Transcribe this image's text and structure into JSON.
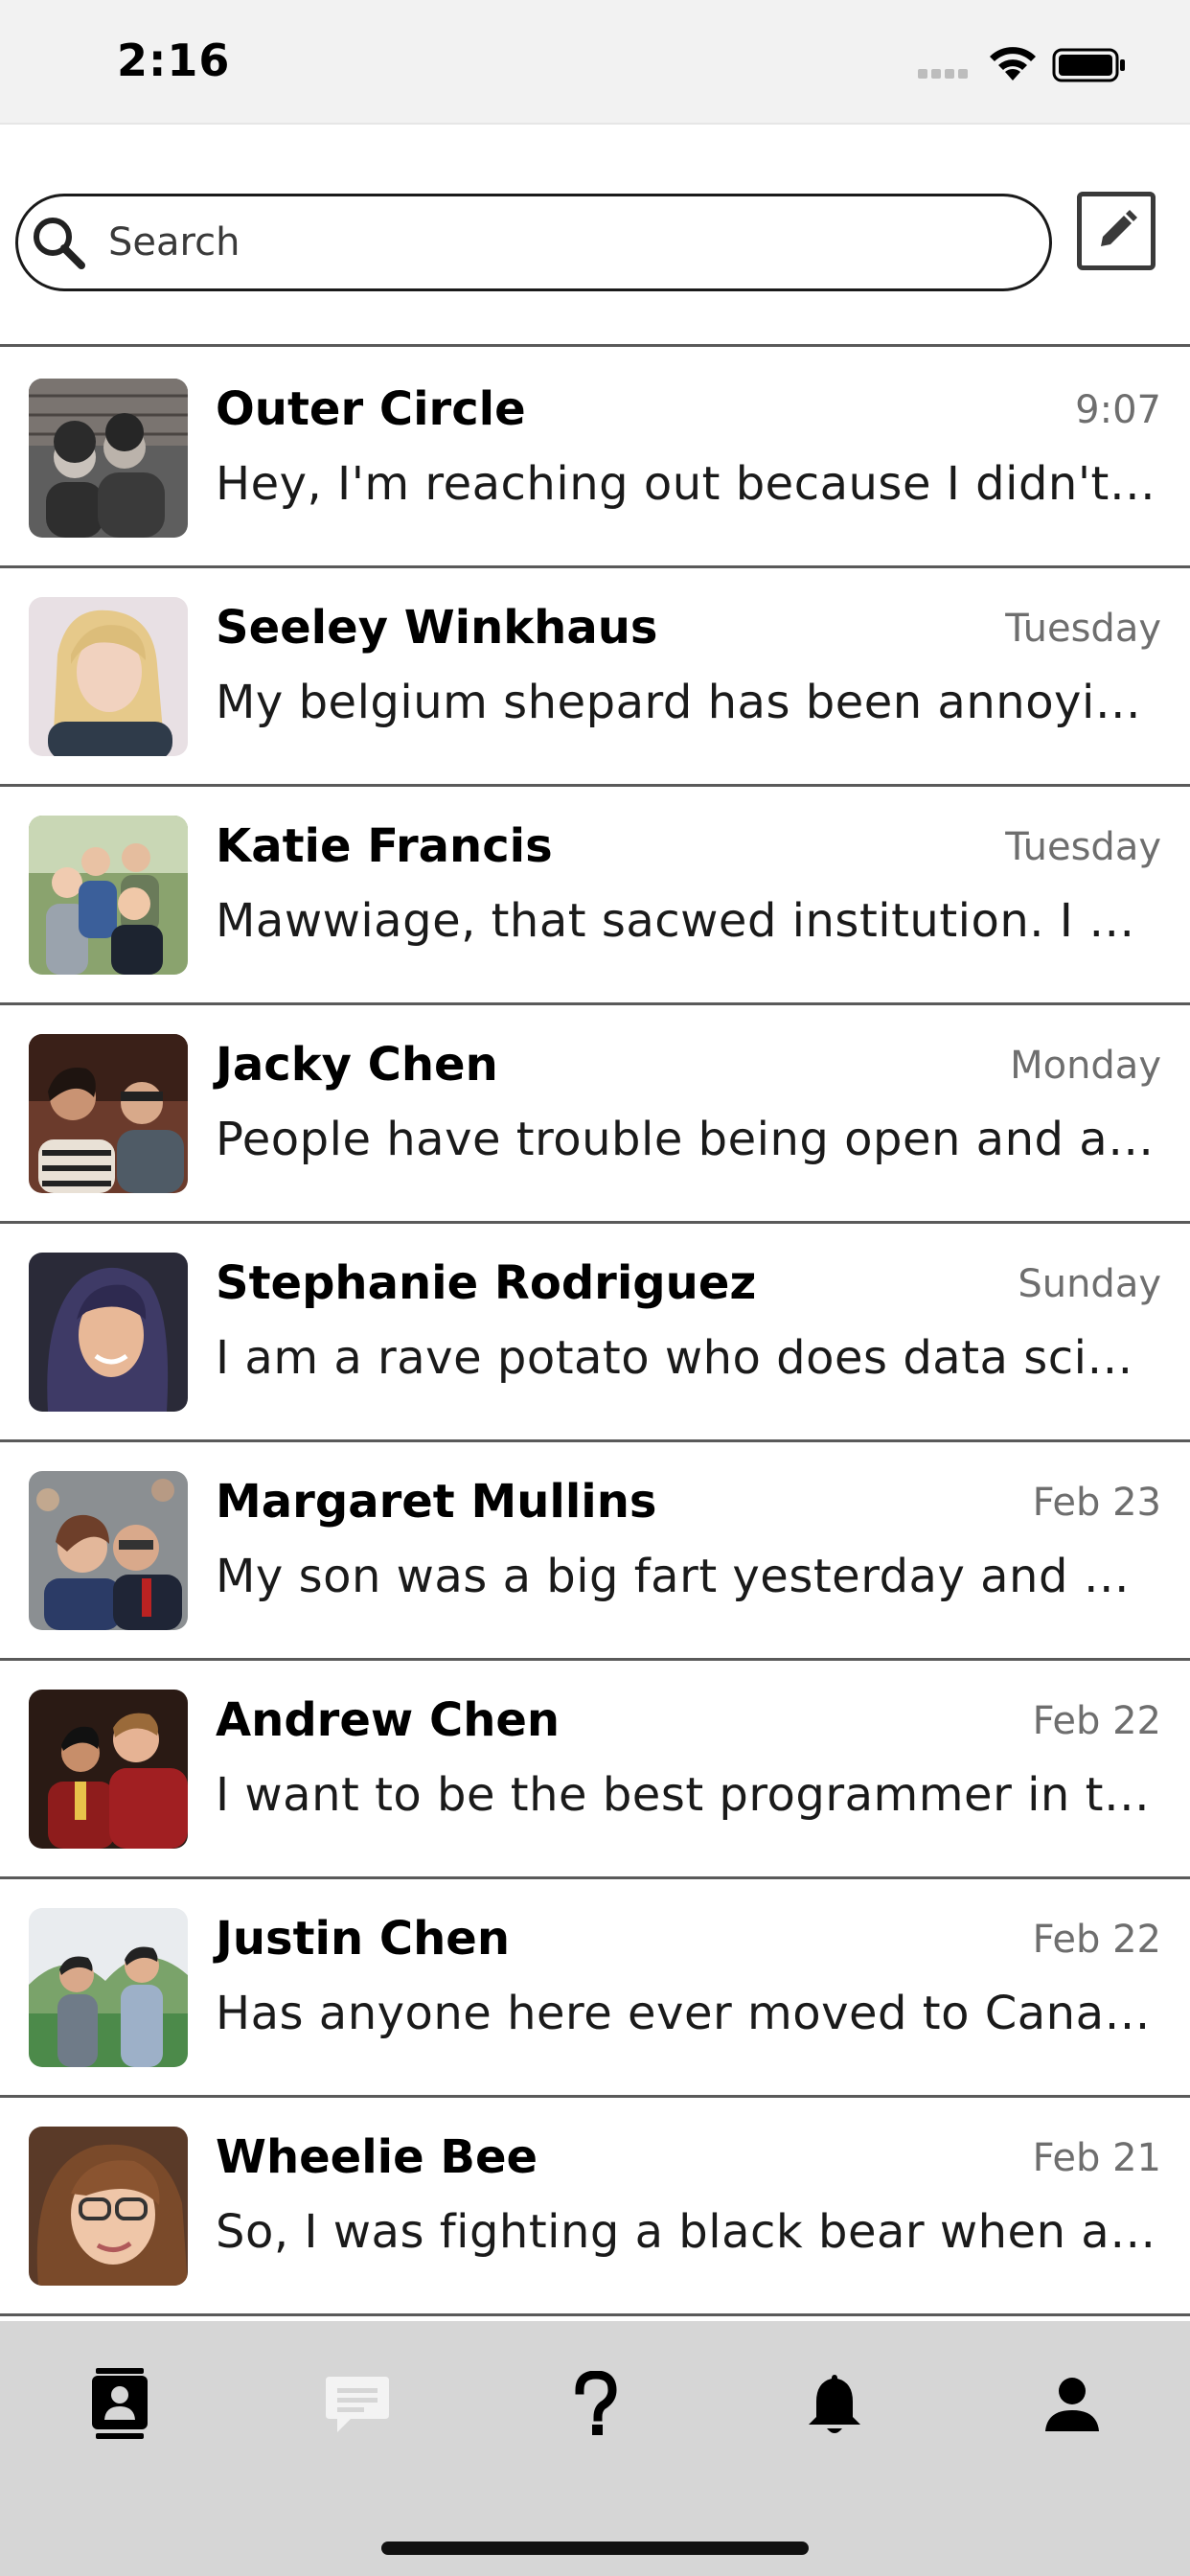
{
  "status_bar": {
    "time": "2:16"
  },
  "search": {
    "placeholder": "Search"
  },
  "conversations": [
    {
      "name": "Outer Circle",
      "time": "9:07",
      "preview": "Hey, I'm reaching out because I didn't li…"
    },
    {
      "name": "Seeley Winkhaus",
      "time": "Tuesday",
      "preview": "My belgium shepard has been annoyin…"
    },
    {
      "name": "Katie Francis",
      "time": "Tuesday",
      "preview": "Mawwiage, that sacwed institution. I wa…"
    },
    {
      "name": "Jacky Chen",
      "time": "Monday",
      "preview": "People have trouble being open and als…"
    },
    {
      "name": "Stephanie Rodriguez",
      "time": "Sunday",
      "preview": "I am a rave potato who does data scienc…"
    },
    {
      "name": "Margaret Mullins",
      "time": "Feb 23",
      "preview": "My son was a big fart yesterday and ma…"
    },
    {
      "name": "Andrew Chen",
      "time": "Feb 22",
      "preview": "I want to be the best programmer in the…"
    },
    {
      "name": "Justin Chen",
      "time": "Feb 22",
      "preview": "Has anyone here ever moved to Canada…"
    },
    {
      "name": "Wheelie Bee",
      "time": "Feb 21",
      "preview": "So, I was fighting a black bear when all…"
    }
  ],
  "tab_bar": {
    "tabs": [
      {
        "icon": "contacts-icon",
        "active": true
      },
      {
        "icon": "messages-icon",
        "active": false
      },
      {
        "icon": "question-icon",
        "active": false
      },
      {
        "icon": "bell-icon",
        "active": false
      },
      {
        "icon": "profile-icon",
        "active": false
      }
    ]
  }
}
